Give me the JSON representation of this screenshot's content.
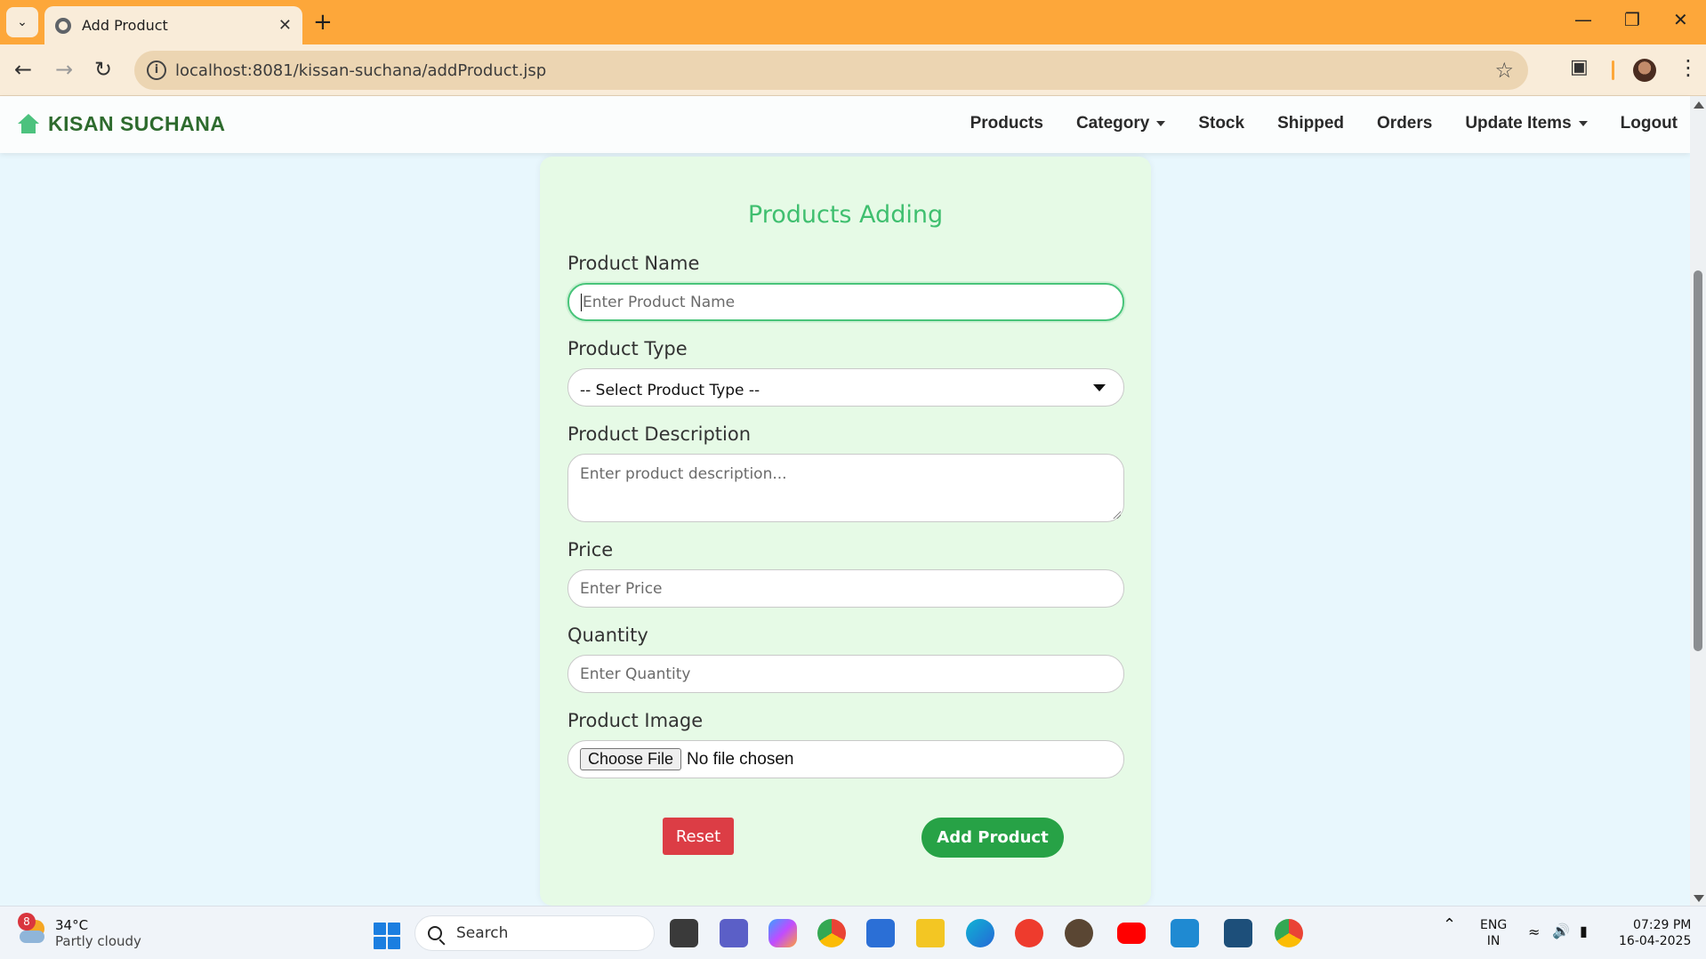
{
  "browser": {
    "tab_title": "Add Product",
    "url": "localhost:8081/kissan-suchana/addProduct.jsp"
  },
  "header": {
    "brand": "KISAN SUCHANA",
    "nav": [
      {
        "label": "Products"
      },
      {
        "label": "Category"
      },
      {
        "label": "Stock"
      },
      {
        "label": "Shipped"
      },
      {
        "label": "Orders"
      },
      {
        "label": "Update Items"
      },
      {
        "label": "Logout"
      }
    ]
  },
  "form": {
    "title": "Products Adding",
    "product_name": {
      "label": "Product Name",
      "placeholder": "Enter Product Name",
      "value": ""
    },
    "product_type": {
      "label": "Product Type",
      "selected": "-- Select Product Type --"
    },
    "description": {
      "label": "Product Description",
      "placeholder": "Enter product description..."
    },
    "price": {
      "label": "Price",
      "placeholder": "Enter Price"
    },
    "quantity": {
      "label": "Quantity",
      "placeholder": "Enter Quantity"
    },
    "image": {
      "label": "Product Image",
      "button": "Choose File",
      "status": "No file chosen"
    },
    "reset_label": "Reset",
    "submit_label": "Add Product"
  },
  "taskbar": {
    "weather_temp": "34°C",
    "weather_desc": "Partly cloudy",
    "weather_badge": "8",
    "search_label": "Search",
    "lang_top": "ENG",
    "lang_bottom": "IN",
    "time": "07:29 PM",
    "date": "16-04-2025"
  },
  "colors": {
    "titlebar": "#fda73a",
    "accent_green": "#27a246",
    "title_green": "#3fbf6f",
    "reset_red": "#dc3d45",
    "card_bg": "#e6fae6",
    "page_bg": "#e8f7fd"
  }
}
